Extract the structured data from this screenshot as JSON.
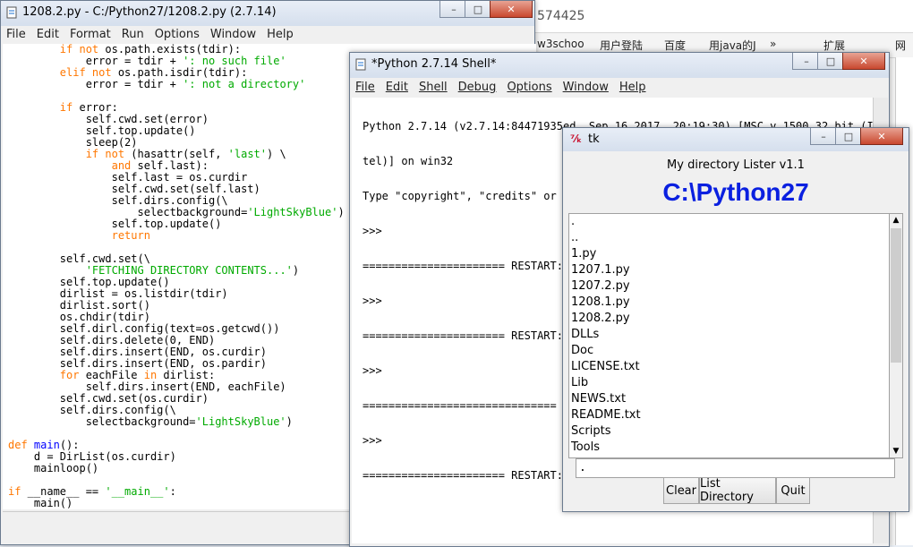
{
  "background": {
    "tab_fragment": "574425",
    "bookmarks": [
      "w3schoo",
      "用户登陆",
      "百度",
      "用java的J",
      "»",
      "扩展",
      "网"
    ]
  },
  "editor": {
    "title": "1208.2.py - C:/Python27/1208.2.py (2.7.14)",
    "menu": [
      "File",
      "Edit",
      "Format",
      "Run",
      "Options",
      "Window",
      "Help"
    ]
  },
  "shell": {
    "title": "*Python 2.7.14 Shell*",
    "menu": [
      "File",
      "Edit",
      "Shell",
      "Debug",
      "Options",
      "Window",
      "Help"
    ],
    "lines": [
      "Python 2.7.14 (v2.7.14:84471935ed, Sep 16 2017, 20:19:30) [MSC v.1500 32 bit (In",
      "tel)] on win32",
      "Type \"copyright\", \"credits\" or \"license()\" for more information.",
      ">>> ",
      "====================== RESTART:",
      ">>> ",
      "====================== RESTART:",
      ">>> ",
      "==============================",
      ">>> ",
      "====================== RESTART:"
    ]
  },
  "tk": {
    "title": "tk",
    "subtitle": "My directory Lister v1.1",
    "heading": "C:\\Python27",
    "items": [
      ".",
      "..",
      "1.py",
      "1207.1.py",
      "1207.2.py",
      "1208.1.py",
      "1208.2.py",
      "DLLs",
      "Doc",
      "LICENSE.txt",
      "Lib",
      "NEWS.txt",
      "README.txt",
      "Scripts",
      "Tools"
    ],
    "entry_value": ".",
    "buttons": {
      "clear": "Clear",
      "list": "List Directory",
      "quit": "Quit"
    }
  }
}
